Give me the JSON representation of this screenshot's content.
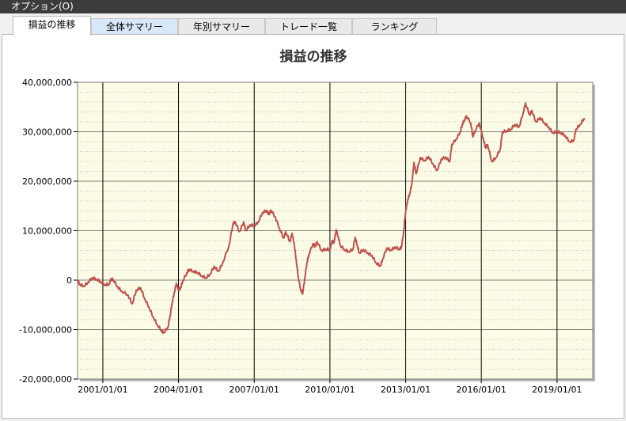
{
  "menu": {
    "options_label": "オプション(O)"
  },
  "tabs": [
    {
      "label": "損益の推移",
      "active": true
    },
    {
      "label": "全体サマリー",
      "active": false
    },
    {
      "label": "年別サマリー",
      "active": false
    },
    {
      "label": "トレード一覧",
      "active": false
    },
    {
      "label": "ランキング",
      "active": false
    }
  ],
  "colors": {
    "line": "#c0504d",
    "plot_bg": "#fcfce6",
    "menubar": "#3c3c3c",
    "hover_tab": "#d8e8f8"
  },
  "chart_data": {
    "type": "line",
    "title": "損益の推移",
    "xlabel": "",
    "ylabel": "",
    "ylim": [
      -20000000,
      40000000
    ],
    "xlim": [
      "2000-01-01",
      "2020-06-01"
    ],
    "y_ticks": [
      {
        "value": 40000000,
        "label": "40,000,000"
      },
      {
        "value": 30000000,
        "label": "30,000,000"
      },
      {
        "value": 20000000,
        "label": "20,000,000"
      },
      {
        "value": 10000000,
        "label": "10,000,000"
      },
      {
        "value": 0,
        "label": "0"
      },
      {
        "value": -10000000,
        "label": "-10,000,000"
      },
      {
        "value": -20000000,
        "label": "-20,000,000"
      }
    ],
    "x_ticks": [
      {
        "value": "2001-01-01",
        "label": "2001/01/01"
      },
      {
        "value": "2004-01-01",
        "label": "2004/01/01"
      },
      {
        "value": "2007-01-01",
        "label": "2007/01/01"
      },
      {
        "value": "2010-01-01",
        "label": "2010/01/01"
      },
      {
        "value": "2013-01-01",
        "label": "2013/01/01"
      },
      {
        "value": "2016-01-01",
        "label": "2016/01/01"
      },
      {
        "value": "2019-01-01",
        "label": "2019/01/01"
      }
    ],
    "grid": true,
    "minor_grid_step": 2000000,
    "series": [
      {
        "color": "#c0504d",
        "points": [
          [
            "2000-01-01",
            0
          ],
          [
            "2000-02-01",
            -800000
          ],
          [
            "2000-04-01",
            -1200000
          ],
          [
            "2000-06-01",
            -400000
          ],
          [
            "2000-08-01",
            500000
          ],
          [
            "2000-10-01",
            200000
          ],
          [
            "2000-12-01",
            -300000
          ],
          [
            "2001-02-01",
            -900000
          ],
          [
            "2001-04-01",
            -800000
          ],
          [
            "2001-05-01",
            300000
          ],
          [
            "2001-06-01",
            100000
          ],
          [
            "2001-08-01",
            -1300000
          ],
          [
            "2001-10-01",
            -2200000
          ],
          [
            "2002-01-01",
            -3000000
          ],
          [
            "2002-03-01",
            -4800000
          ],
          [
            "2002-05-01",
            -2000000
          ],
          [
            "2002-07-01",
            -1500000
          ],
          [
            "2002-09-01",
            -3800000
          ],
          [
            "2002-11-01",
            -5500000
          ],
          [
            "2003-01-01",
            -7500000
          ],
          [
            "2003-03-01",
            -9000000
          ],
          [
            "2003-05-01",
            -10200000
          ],
          [
            "2003-06-01",
            -10600000
          ],
          [
            "2003-08-01",
            -9500000
          ],
          [
            "2003-09-01",
            -7200000
          ],
          [
            "2003-10-01",
            -4500000
          ],
          [
            "2003-11-01",
            -2500000
          ],
          [
            "2003-12-01",
            -600000
          ],
          [
            "2004-01-01",
            -2000000
          ],
          [
            "2004-02-01",
            -1500000
          ],
          [
            "2004-03-01",
            -200000
          ],
          [
            "2004-05-01",
            1500000
          ],
          [
            "2004-06-01",
            2200000
          ],
          [
            "2004-08-01",
            1800000
          ],
          [
            "2004-10-01",
            1600000
          ],
          [
            "2004-12-01",
            900000
          ],
          [
            "2005-02-01",
            500000
          ],
          [
            "2005-04-01",
            1200000
          ],
          [
            "2005-06-01",
            2800000
          ],
          [
            "2005-08-01",
            1800000
          ],
          [
            "2005-10-01",
            3500000
          ],
          [
            "2006-01-01",
            7000000
          ],
          [
            "2006-03-01",
            11500000
          ],
          [
            "2006-04-01",
            11800000
          ],
          [
            "2006-06-01",
            9800000
          ],
          [
            "2006-08-01",
            11800000
          ],
          [
            "2006-09-01",
            10000000
          ],
          [
            "2006-11-01",
            11200000
          ],
          [
            "2007-01-01",
            11000000
          ],
          [
            "2007-03-01",
            11800000
          ],
          [
            "2007-05-01",
            13700000
          ],
          [
            "2007-07-01",
            14100000
          ],
          [
            "2007-08-01",
            13300000
          ],
          [
            "2007-09-01",
            14200000
          ],
          [
            "2007-11-01",
            12800000
          ],
          [
            "2008-01-01",
            10500000
          ],
          [
            "2008-03-01",
            8500000
          ],
          [
            "2008-04-01",
            9800000
          ],
          [
            "2008-06-01",
            7800000
          ],
          [
            "2008-07-01",
            9500000
          ],
          [
            "2008-08-01",
            7400000
          ],
          [
            "2008-09-01",
            4000000
          ],
          [
            "2008-10-01",
            500000
          ],
          [
            "2008-11-01",
            -1700000
          ],
          [
            "2008-12-01",
            -2800000
          ],
          [
            "2009-01-01",
            300000
          ],
          [
            "2009-02-01",
            3500000
          ],
          [
            "2009-03-01",
            5200000
          ],
          [
            "2009-05-01",
            7400000
          ],
          [
            "2009-06-01",
            6800000
          ],
          [
            "2009-07-01",
            7800000
          ],
          [
            "2009-09-01",
            6000000
          ],
          [
            "2009-11-01",
            6300000
          ],
          [
            "2010-01-01",
            6200000
          ],
          [
            "2010-02-01",
            8000000
          ],
          [
            "2010-03-01",
            7600000
          ],
          [
            "2010-04-01",
            10200000
          ],
          [
            "2010-05-01",
            8800000
          ],
          [
            "2010-06-01",
            7000000
          ],
          [
            "2010-08-01",
            6200000
          ],
          [
            "2010-10-01",
            5800000
          ],
          [
            "2010-12-01",
            6300000
          ],
          [
            "2011-01-01",
            8700000
          ],
          [
            "2011-02-01",
            7000000
          ],
          [
            "2011-03-01",
            5500000
          ],
          [
            "2011-05-01",
            6200000
          ],
          [
            "2011-07-01",
            5500000
          ],
          [
            "2011-09-01",
            5000000
          ],
          [
            "2011-11-01",
            3500000
          ],
          [
            "2012-01-01",
            2900000
          ],
          [
            "2012-02-01",
            4200000
          ],
          [
            "2012-04-01",
            6500000
          ],
          [
            "2012-06-01",
            6100000
          ],
          [
            "2012-08-01",
            6700000
          ],
          [
            "2012-10-01",
            6300000
          ],
          [
            "2012-11-01",
            6700000
          ],
          [
            "2012-12-01",
            9500000
          ],
          [
            "2013-01-01",
            14000000
          ],
          [
            "2013-02-01",
            16300000
          ],
          [
            "2013-03-01",
            17500000
          ],
          [
            "2013-04-01",
            19500000
          ],
          [
            "2013-05-01",
            23800000
          ],
          [
            "2013-06-01",
            21500000
          ],
          [
            "2013-08-01",
            24800000
          ],
          [
            "2013-10-01",
            24200000
          ],
          [
            "2013-12-01",
            25000000
          ],
          [
            "2014-02-01",
            23500000
          ],
          [
            "2014-04-01",
            22200000
          ],
          [
            "2014-06-01",
            24500000
          ],
          [
            "2014-08-01",
            24900000
          ],
          [
            "2014-10-01",
            24000000
          ],
          [
            "2014-11-01",
            27500000
          ],
          [
            "2015-01-01",
            28500000
          ],
          [
            "2015-03-01",
            30000000
          ],
          [
            "2015-04-01",
            31500000
          ],
          [
            "2015-05-01",
            32400000
          ],
          [
            "2015-06-01",
            33200000
          ],
          [
            "2015-08-01",
            31800000
          ],
          [
            "2015-09-01",
            29000000
          ],
          [
            "2015-10-01",
            30200000
          ],
          [
            "2015-12-01",
            31800000
          ],
          [
            "2016-02-01",
            28500000
          ],
          [
            "2016-03-01",
            26800000
          ],
          [
            "2016-04-01",
            27400000
          ],
          [
            "2016-06-01",
            24000000
          ],
          [
            "2016-08-01",
            24800000
          ],
          [
            "2016-10-01",
            26500000
          ],
          [
            "2016-11-01",
            30000000
          ],
          [
            "2017-01-01",
            30200000
          ],
          [
            "2017-03-01",
            30500000
          ],
          [
            "2017-05-01",
            31500000
          ],
          [
            "2017-07-01",
            31000000
          ],
          [
            "2017-09-01",
            34000000
          ],
          [
            "2017-10-01",
            35800000
          ],
          [
            "2017-12-01",
            33400000
          ],
          [
            "2018-01-01",
            34300000
          ],
          [
            "2018-03-01",
            32000000
          ],
          [
            "2018-05-01",
            32900000
          ],
          [
            "2018-07-01",
            31800000
          ],
          [
            "2018-09-01",
            31000000
          ],
          [
            "2018-11-01",
            29800000
          ],
          [
            "2019-01-01",
            30100000
          ],
          [
            "2019-03-01",
            29800000
          ],
          [
            "2019-05-01",
            29200000
          ],
          [
            "2019-07-01",
            28000000
          ],
          [
            "2019-09-01",
            28300000
          ],
          [
            "2019-10-01",
            30500000
          ],
          [
            "2019-12-01",
            31500000
          ],
          [
            "2020-02-01",
            32800000
          ]
        ]
      }
    ]
  }
}
